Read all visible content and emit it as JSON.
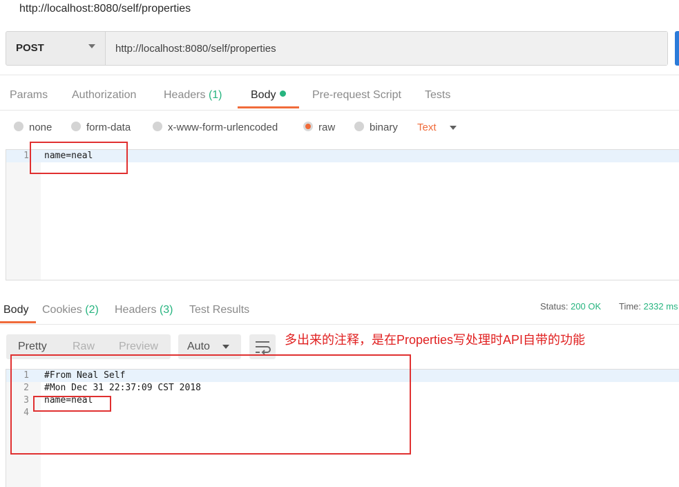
{
  "request": {
    "title": "http://localhost:8080/self/properties",
    "method": "POST",
    "url": "http://localhost:8080/self/properties"
  },
  "request_tabs": {
    "params": "Params",
    "authorization": "Authorization",
    "headers": "Headers",
    "headers_count": "(1)",
    "body": "Body",
    "prerequest": "Pre-request Script",
    "tests": "Tests"
  },
  "body_types": {
    "none": "none",
    "form_data": "form-data",
    "urlencoded": "x-www-form-urlencoded",
    "raw": "raw",
    "binary": "binary",
    "selected": "raw",
    "text_type": "Text"
  },
  "request_body": {
    "lines": [
      {
        "num": "1",
        "text": "name=neal"
      }
    ]
  },
  "response_tabs": {
    "body": "Body",
    "cookies": "Cookies",
    "cookies_count": "(2)",
    "headers": "Headers",
    "headers_count": "(3)",
    "test_results": "Test Results"
  },
  "response_status": {
    "status_label": "Status:",
    "status_value": "200 OK",
    "time_label": "Time:",
    "time_value": "2332 ms"
  },
  "response_view": {
    "pretty": "Pretty",
    "raw": "Raw",
    "preview": "Preview",
    "format": "Auto"
  },
  "annotation": "多出来的注释，是在Properties写处理时API自带的功能",
  "response_body": {
    "lines": [
      {
        "num": "1",
        "text": "#From Neal Self"
      },
      {
        "num": "2",
        "text": "#Mon Dec 31 22:37:09 CST 2018"
      },
      {
        "num": "3",
        "text": "name=neal"
      },
      {
        "num": "4",
        "text": ""
      }
    ]
  },
  "colors": {
    "accent": "#f06b3a",
    "success": "#26b47f",
    "send_button": "#2b7bd9",
    "annotation_red": "#e02020"
  }
}
